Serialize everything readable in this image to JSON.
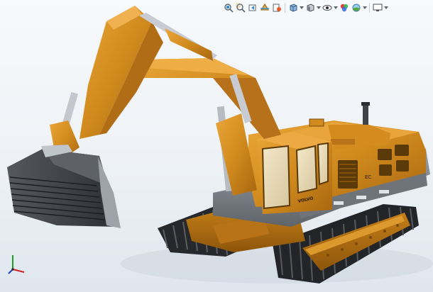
{
  "viewport": {
    "background_top": "#f7f9fb",
    "background_bottom": "#dfe6ee"
  },
  "model": {
    "cab_decal": "VOLVO",
    "counterweight_decal": "EC",
    "body_color": "#d08a1e",
    "body_shadow": "#9c5f0c",
    "body_highlight": "#eba63a",
    "track_color": "#2a2c30",
    "bucket_color": "#3a3c40"
  },
  "heads_up_toolbar": {
    "icons": [
      "zoom-to-fit-icon",
      "zoom-to-area-icon",
      "previous-view-icon",
      "section-view-icon",
      "dynamic-annotation-icon",
      "view-orientation-icon",
      "display-style-icon",
      "hide-show-items-icon",
      "edit-appearance-icon",
      "apply-scene-icon",
      "view-settings-icon"
    ]
  },
  "triad": {
    "x_axis_color": "#d02020",
    "y_axis_color": "#20a020",
    "z_axis_color": "#2040d0"
  }
}
